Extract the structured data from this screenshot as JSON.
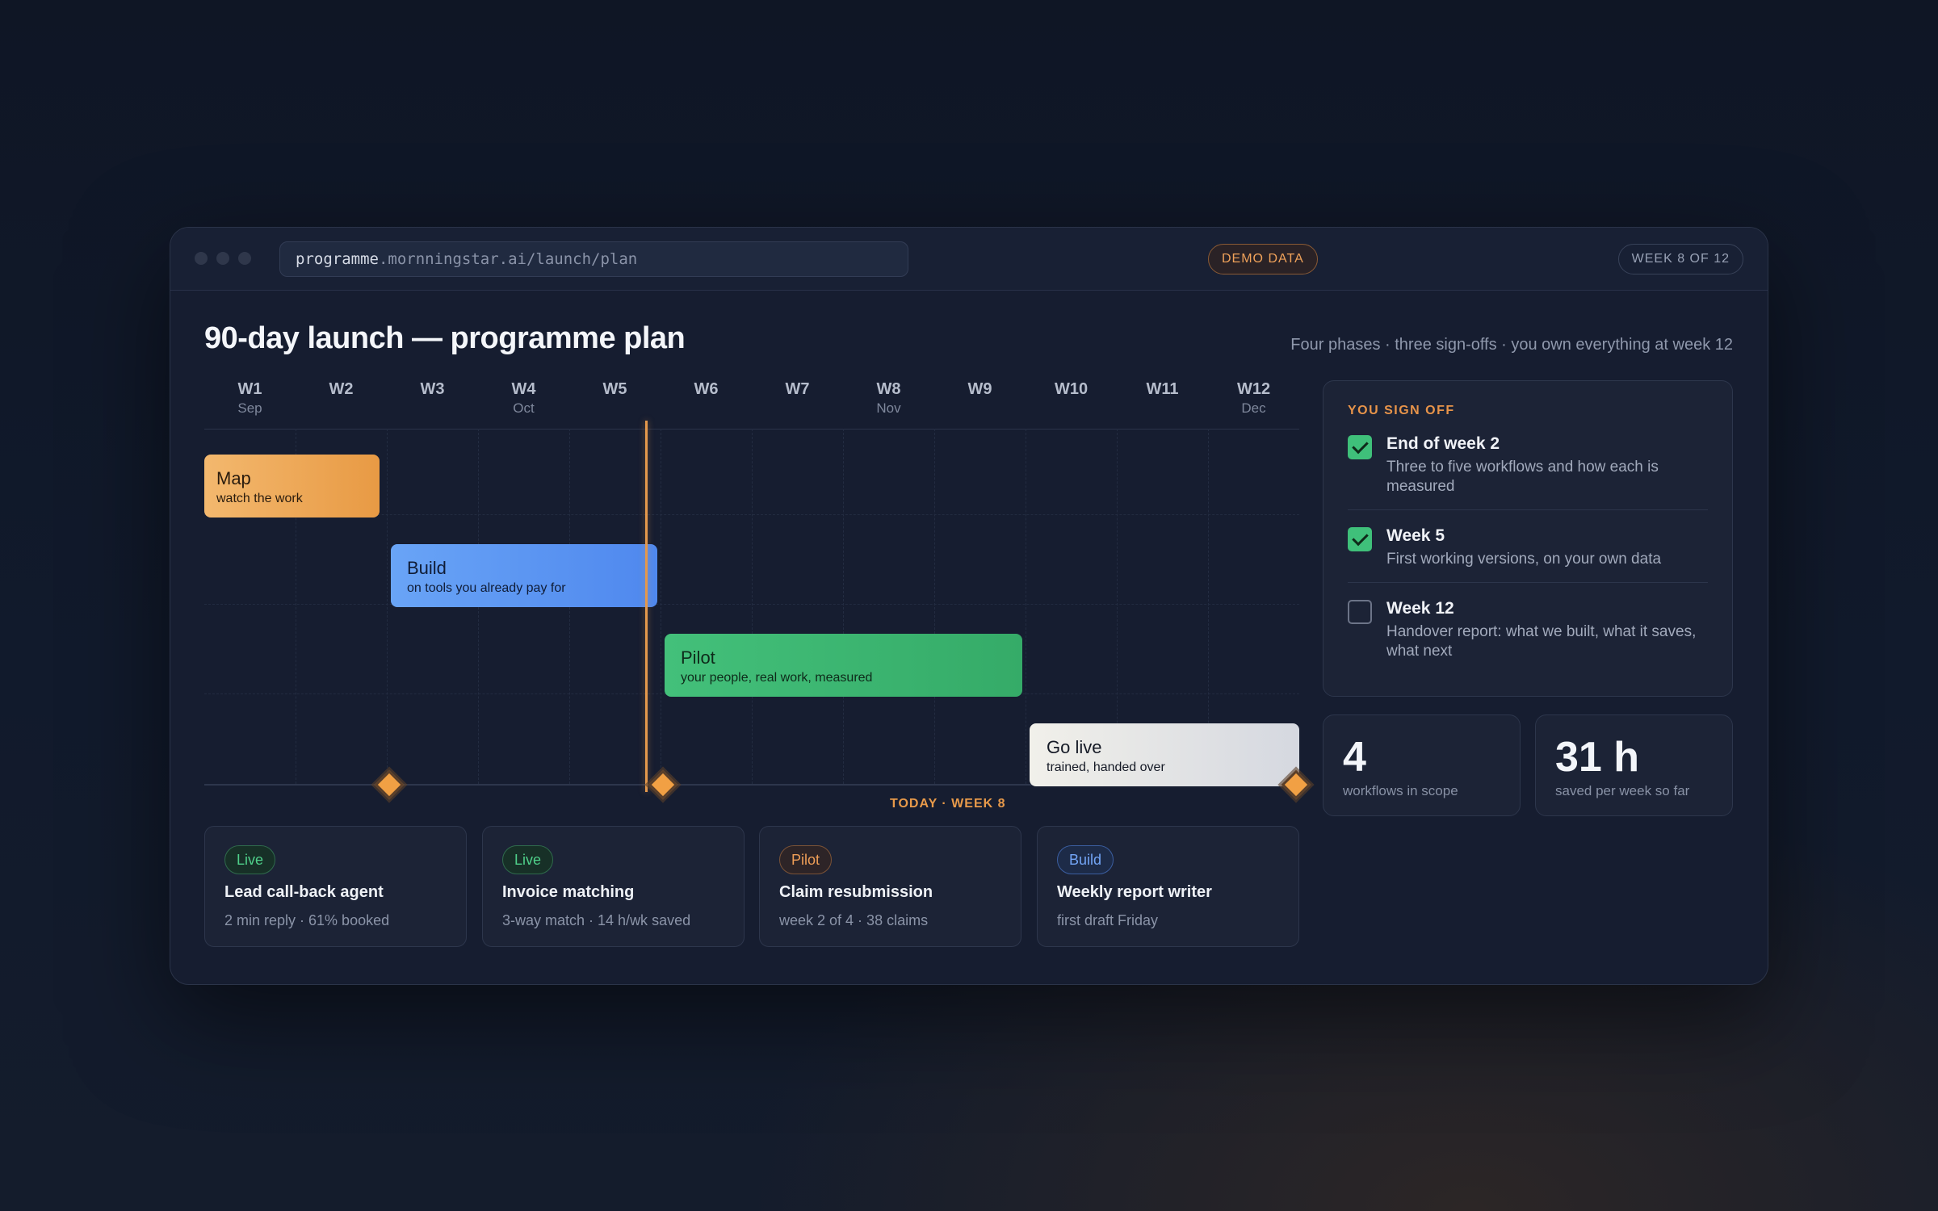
{
  "browser": {
    "url_host": "programme",
    "url_rest": ".mornningstar.ai/launch/plan",
    "demo_badge": "DEMO DATA",
    "week_badge": "WEEK 8 OF 12"
  },
  "header": {
    "title": "90-day launch — programme plan",
    "subtitle": "Four phases · three sign-offs · you own everything at week 12"
  },
  "timeline": {
    "weeks": [
      {
        "label": "W1",
        "month": "Sep"
      },
      {
        "label": "W2",
        "month": ""
      },
      {
        "label": "W3",
        "month": ""
      },
      {
        "label": "W4",
        "month": "Oct"
      },
      {
        "label": "W5",
        "month": ""
      },
      {
        "label": "W6",
        "month": ""
      },
      {
        "label": "W7",
        "month": ""
      },
      {
        "label": "W8",
        "month": "Nov"
      },
      {
        "label": "W9",
        "month": ""
      },
      {
        "label": "W10",
        "month": ""
      },
      {
        "label": "W11",
        "month": ""
      },
      {
        "label": "W12",
        "month": "Dec"
      }
    ],
    "phases": [
      {
        "name": "Map",
        "desc": "watch the work",
        "color": "#ee a955"
      },
      {
        "name": "Build",
        "desc": "on tools you already pay for",
        "color": "#5b95f2"
      },
      {
        "name": "Pilot",
        "desc": "your people, real work, measured",
        "color": "#3cb671"
      },
      {
        "name": "Go live",
        "desc": "trained, handed over",
        "color": "#e4e5e6"
      }
    ],
    "today_label": "TODAY · WEEK 8",
    "accent_color": "#e89a4a"
  },
  "workflows": [
    {
      "status": "Live",
      "name": "Lead call-back agent",
      "meta": "2 min reply · 61% booked"
    },
    {
      "status": "Live",
      "name": "Invoice matching",
      "meta": "3-way match · 14 h/wk saved"
    },
    {
      "status": "Pilot",
      "name": "Claim resubmission",
      "meta": "week 2 of 4 · 38 claims"
    },
    {
      "status": "Build",
      "name": "Weekly report writer",
      "meta": "first draft Friday"
    }
  ],
  "signoff": {
    "heading": "YOU SIGN OFF",
    "items": [
      {
        "title": "End of week 2",
        "desc": "Three to five workflows and how each is measured",
        "checked": true
      },
      {
        "title": "Week 5",
        "desc": "First working versions, on your own data",
        "checked": true
      },
      {
        "title": "Week 12",
        "desc": "Handover report: what we built, what it saves, what next",
        "checked": false
      }
    ]
  },
  "stats": [
    {
      "value": "4",
      "label": "workflows in scope"
    },
    {
      "value": "31 h",
      "label": "saved per week so far"
    }
  ]
}
